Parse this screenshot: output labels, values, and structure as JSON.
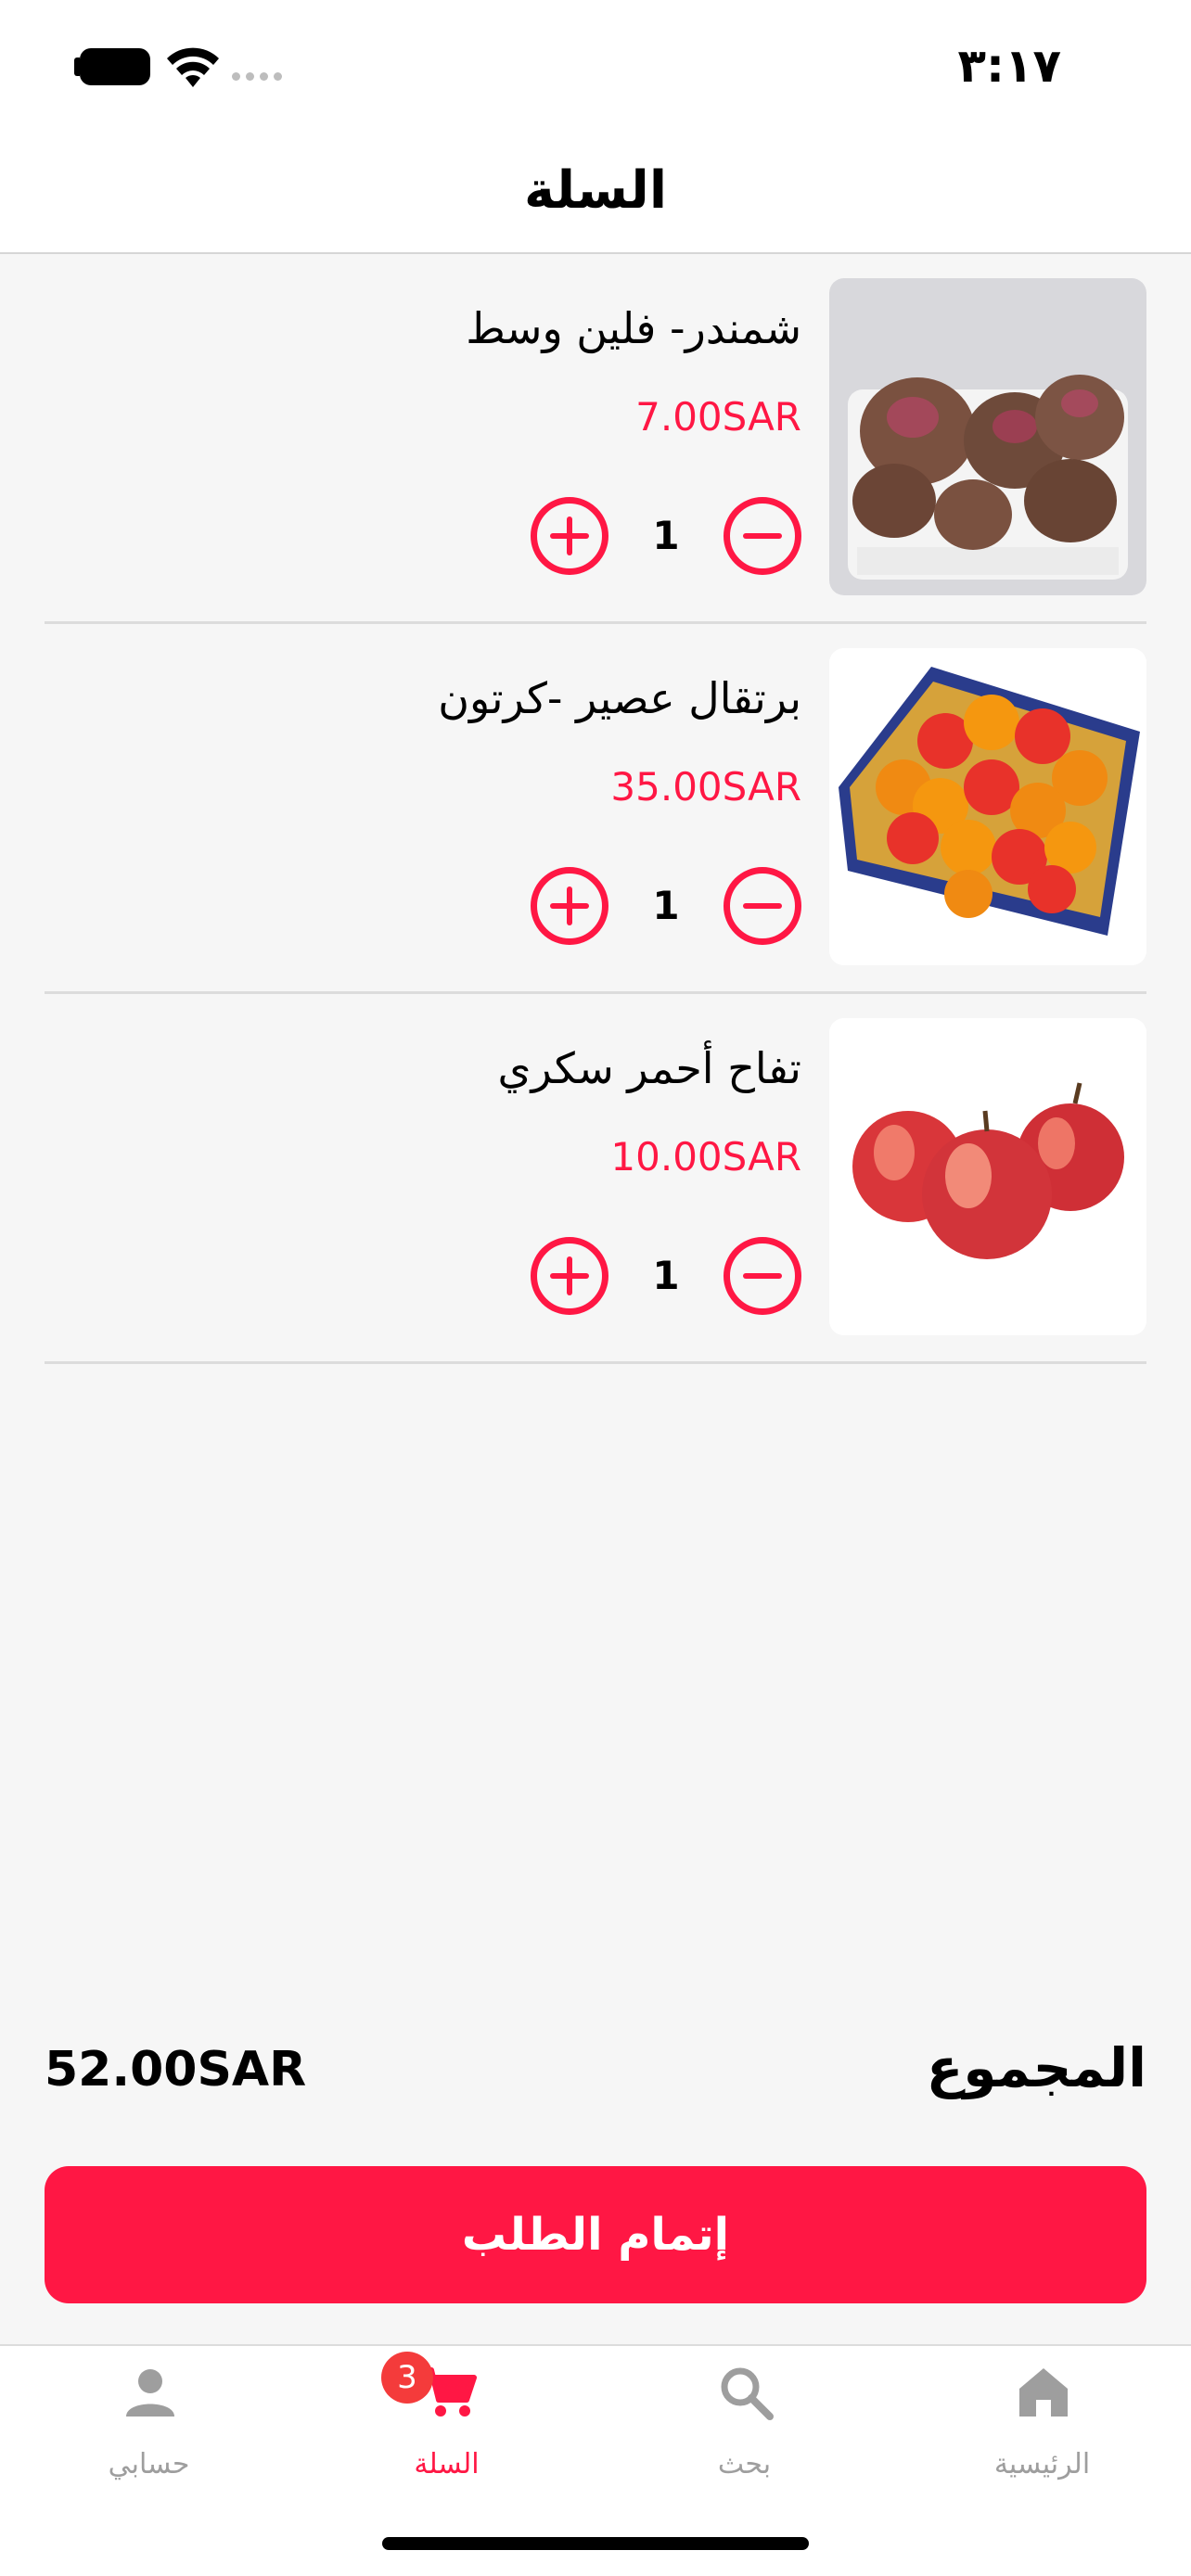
{
  "status_bar": {
    "time": "٣:١٧"
  },
  "header": {
    "title": "السلة"
  },
  "cart": {
    "items": [
      {
        "name": "شمندر- فلين وسط",
        "price": "7.00SAR",
        "quantity": "1"
      },
      {
        "name": "برتقال عصير -كرتون",
        "price": "35.00SAR",
        "quantity": "1"
      },
      {
        "name": "تفاح أحمر سكري",
        "price": "10.00SAR",
        "quantity": "1"
      }
    ]
  },
  "summary": {
    "total_label": "المجموع",
    "total_value": "52.00SAR"
  },
  "checkout": {
    "label": "إتمام الطلب"
  },
  "tabs": [
    {
      "label": "الرئيسية",
      "icon": "home-icon"
    },
    {
      "label": "بحث",
      "icon": "search-icon"
    },
    {
      "label": "السلة",
      "icon": "cart-icon",
      "badge": "3",
      "active": true
    },
    {
      "label": "حسابي",
      "icon": "person-icon"
    }
  ],
  "colors": {
    "accent": "#ff1744",
    "inactive": "#9e9e9e",
    "badge": "#f43b3b"
  }
}
